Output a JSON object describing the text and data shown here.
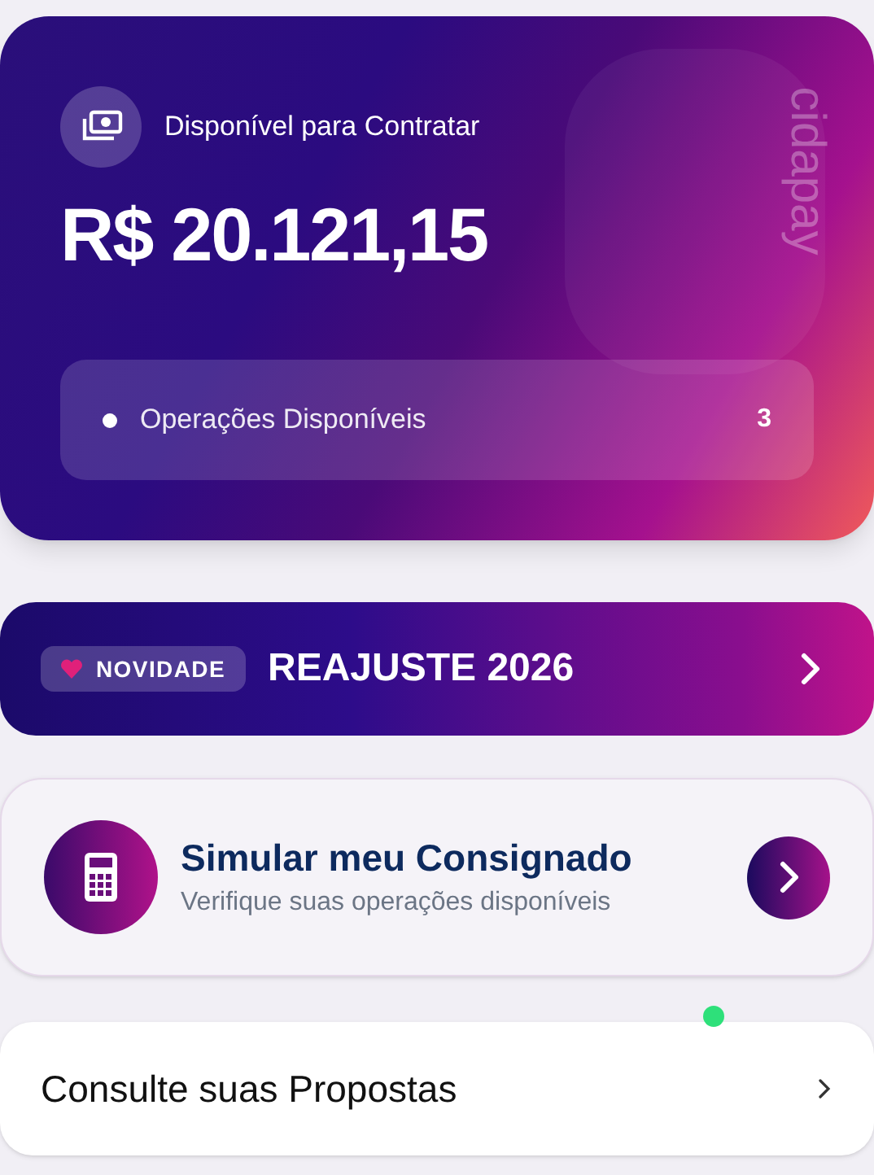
{
  "balance_card": {
    "label": "Disponível para Contratar",
    "amount": "R$ 20.121,15",
    "brand": "cidapay",
    "operations": {
      "label": "Operações Disponíveis",
      "count": "3"
    }
  },
  "banner": {
    "badge": "NOVIDADE",
    "title": "REAJUSTE 2026"
  },
  "simulate_card": {
    "title": "Simular meu Consignado",
    "subtitle": "Verifique suas operações disponíveis"
  },
  "proposals_row": {
    "label": "Consulte suas Propostas"
  }
}
